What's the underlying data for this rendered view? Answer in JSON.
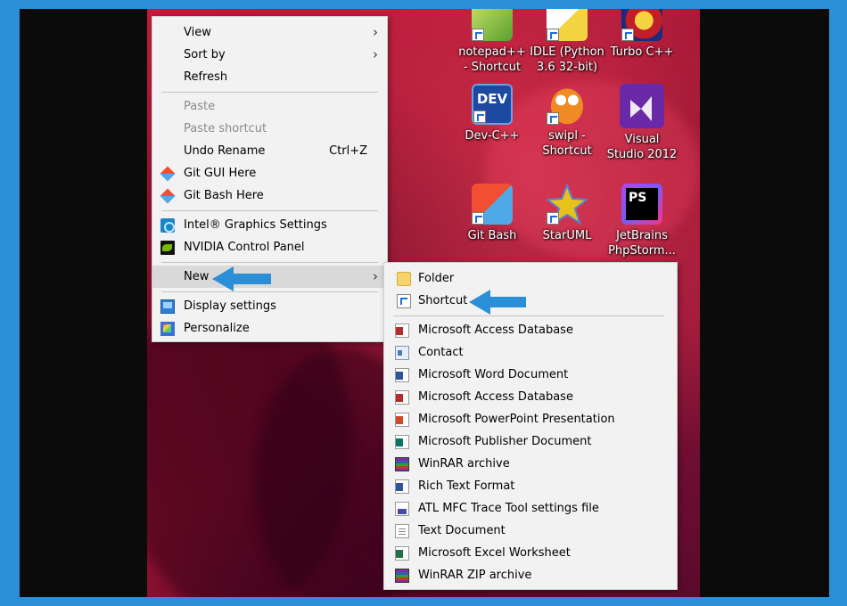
{
  "desktop_icons": [
    {
      "label": "notepad++ - Shortcut",
      "icon": "notepadpp-icon"
    },
    {
      "label": "IDLE (Python 3.6 32-bit)",
      "icon": "python-idle-icon"
    },
    {
      "label": "Turbo C++",
      "icon": "turbo-cpp-icon"
    },
    {
      "label": "Dev-C++",
      "icon": "devcpp-icon",
      "tile_text": "DEV"
    },
    {
      "label": "swipl - Shortcut",
      "icon": "owl-icon"
    },
    {
      "label": "Visual Studio 2012",
      "icon": "visual-studio-icon"
    },
    {
      "label": "Git Bash",
      "icon": "git-bash-icon"
    },
    {
      "label": "StarUML",
      "icon": "staruml-icon"
    },
    {
      "label": "JetBrains PhpStorm...",
      "icon": "phpstorm-icon",
      "tile_text": "PS"
    }
  ],
  "context_menu": {
    "view": "View",
    "sort_by": "Sort by",
    "refresh": "Refresh",
    "paste": "Paste",
    "paste_shortcut": "Paste shortcut",
    "undo_rename": "Undo Rename",
    "undo_rename_shortcut": "Ctrl+Z",
    "git_gui": "Git GUI Here",
    "git_bash": "Git Bash Here",
    "intel_graphics": "Intel® Graphics Settings",
    "nvidia": "NVIDIA Control Panel",
    "new": "New",
    "display_settings": "Display settings",
    "personalize": "Personalize",
    "chevron": "›"
  },
  "new_submenu": {
    "folder": "Folder",
    "shortcut": "Shortcut",
    "items": [
      {
        "label": "Microsoft Access Database",
        "icon": "access-icon"
      },
      {
        "label": "Contact",
        "icon": "contact-icon"
      },
      {
        "label": "Microsoft Word Document",
        "icon": "word-icon"
      },
      {
        "label": "Microsoft Access Database",
        "icon": "access-icon"
      },
      {
        "label": "Microsoft PowerPoint Presentation",
        "icon": "powerpoint-icon"
      },
      {
        "label": "Microsoft Publisher Document",
        "icon": "publisher-icon"
      },
      {
        "label": "WinRAR archive",
        "icon": "winrar-icon"
      },
      {
        "label": "Rich Text Format",
        "icon": "rtf-icon"
      },
      {
        "label": "ATL MFC Trace Tool settings file",
        "icon": "atl-trace-icon"
      },
      {
        "label": "Text Document",
        "icon": "text-document-icon"
      },
      {
        "label": "Microsoft Excel Worksheet",
        "icon": "excel-icon"
      },
      {
        "label": "WinRAR ZIP archive",
        "icon": "winrar-zip-icon"
      }
    ]
  },
  "colors": {
    "annotation_arrow": "#2a8fd6",
    "menu_bg": "#f2f2f2",
    "highlight": "#d9d9d9"
  }
}
